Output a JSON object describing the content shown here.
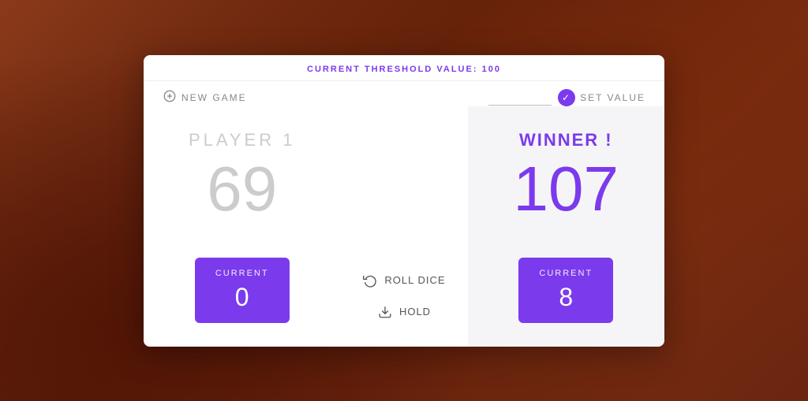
{
  "background": {
    "color": "#6b2c1a"
  },
  "threshold": {
    "label": "CURRENT THRESHOLD VALUE:",
    "value": "100"
  },
  "header": {
    "new_game_label": "NEW GAME",
    "set_value_label": "SET VALUE",
    "threshold_input_value": ""
  },
  "player1": {
    "name": "PLAYER 1",
    "score": "69",
    "current_label": "CURRENT",
    "current_value": "0"
  },
  "player2": {
    "name": "WINNER !",
    "score": "107",
    "current_label": "CURRENT",
    "current_value": "8"
  },
  "controls": {
    "roll_dice_label": "ROLL DICE",
    "hold_label": "HOLD"
  }
}
